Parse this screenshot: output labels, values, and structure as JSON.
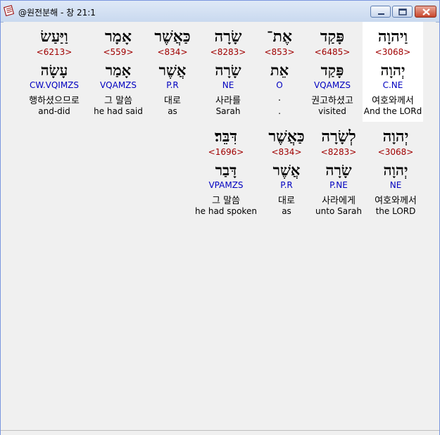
{
  "window": {
    "title": "@원전분해 - 창 21:1"
  },
  "icons": {
    "app": "bible-book-icon",
    "minimize": "minimize-icon",
    "maximize": "maximize-icon",
    "close": "close-icon"
  },
  "colors": {
    "strong_number": "#a00000",
    "morphology": "#0000c0",
    "selected_cell": "#ffffff"
  },
  "rows": [
    {
      "cells": [
        {
          "hebrew": "וַיהוָה",
          "strong": "<3068>",
          "lemma": "יְהוָה",
          "morph": "C.NE",
          "korean": "여호와께서",
          "english": "And the LORd",
          "selected": true
        },
        {
          "hebrew": "פָּקַד",
          "strong": "<6485>",
          "lemma": "פָּקַד",
          "morph": "VQAMZS",
          "korean": "권고하셨고",
          "english": "visited"
        },
        {
          "hebrew": "אֶת־",
          "strong": "<853>",
          "lemma": "אֵת",
          "morph": "O",
          "korean": ".",
          "english": "."
        },
        {
          "hebrew": "שָׂרָה",
          "strong": "<8283>",
          "lemma": "שָׂרָה",
          "morph": "NE",
          "korean": "사라를",
          "english": "Sarah"
        },
        {
          "hebrew": "כַּאֲשֶׁר",
          "strong": "<834>",
          "lemma": "אֲשֶׁר",
          "morph": "P.R",
          "korean": "대로",
          "english": "as"
        },
        {
          "hebrew": "אָמָר",
          "strong": "<559>",
          "lemma": "אָמַר",
          "morph": "VQAMZS",
          "korean": "그 말씀",
          "english": "he had said"
        },
        {
          "hebrew": "וַיַּעַשׂ",
          "strong": "<6213>",
          "lemma": "עָשָׂה",
          "morph": "CW.VQIMZS",
          "korean": "행하셨으므로",
          "english": "and-did"
        }
      ]
    },
    {
      "cells": [
        {
          "hebrew": "יְהוָה",
          "strong": "<3068>",
          "lemma": "יְהוָה",
          "morph": "NE",
          "korean": "여호와께서",
          "english": "the LORD"
        },
        {
          "hebrew": "לְשָׂרָה",
          "strong": "<8283>",
          "lemma": "שָׂרָה",
          "morph": "P.NE",
          "korean": "사라에게",
          "english": "unto Sarah"
        },
        {
          "hebrew": "כַּאֲשֶׁר",
          "strong": "<834>",
          "lemma": "אֲשֶׁר",
          "morph": "P.R",
          "korean": "대로",
          "english": "as"
        },
        {
          "hebrew": "דִּבֵּר׃",
          "strong": "<1696>",
          "lemma": "דָּבַר",
          "morph": "VPAMZS",
          "korean": "그 말씀",
          "english": "he had spoken"
        }
      ]
    }
  ]
}
